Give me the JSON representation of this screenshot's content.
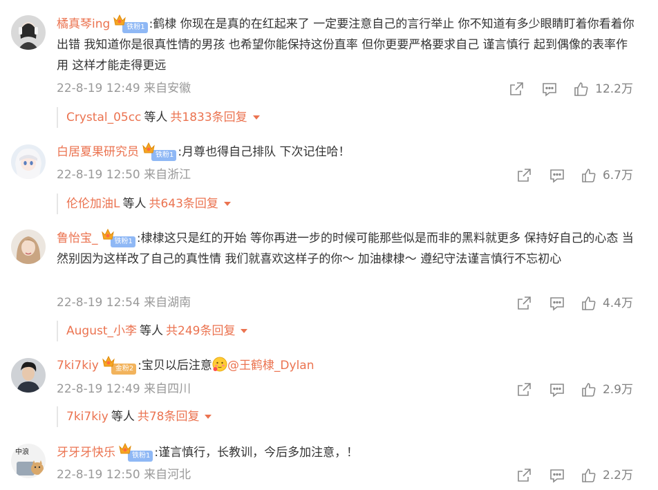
{
  "colors": {
    "username": "#eb7350",
    "meta": "#999999",
    "text": "#333333",
    "badge_blue": "#8fb8f5",
    "badge_gold": "#f2b35c"
  },
  "comments": [
    {
      "username": "橘真琴ing",
      "badge_label": "铁粉1",
      "badge_type": "blue",
      "text": ":鹤棣 你现在是真的在红起来了 一定要注意自己的言行举止 你不知道有多少眼睛盯着你看着你出错 我知道你是很真性情的男孩 也希望你能保持这份直率 但你更要严格要求自己 谨言慎行 起到偶像的表率作用 这样才能走得更远",
      "time": "22-8-19 12:49",
      "location": "来自安徽",
      "likes": "12.2万",
      "reply_user": "Crystal_05cc",
      "reply_mid": "等人",
      "reply_total": "共1833条回复",
      "icons": [
        "share-icon",
        "comment-icon",
        "like-icon",
        "chevron-down-icon"
      ]
    },
    {
      "username": "白居夏果研究员",
      "badge_label": "铁粉1",
      "badge_type": "blue",
      "text": ":月尊也得自己排队 下次记住哈！",
      "time": "22-8-19 12:50",
      "location": "来自浙江",
      "likes": "6.7万",
      "reply_user": "伦伦加油L",
      "reply_mid": "等人",
      "reply_total": "共643条回复"
    },
    {
      "username": "鲁怡宝_",
      "badge_label": "铁粉1",
      "badge_type": "blue",
      "text": ":棣棣这只是红的开始 等你再进一步的时候可能那些似是而非的黑料就更多 保持好自己的心态 当然别因为这样改了自己的真性情 我们就喜欢这样子的你～ 加油棣棣～  遵纪守法谨言慎行不忘初心",
      "time": "22-8-19 12:54",
      "location": "来自湖南",
      "likes": "4.4万",
      "reply_user": "August_小李",
      "reply_mid": "等人",
      "reply_total": "共249条回复"
    },
    {
      "username": "7ki7kiy",
      "badge_label": "金粉2",
      "badge_type": "gold",
      "text_before": ":宝贝以后注意",
      "mention": "@王鹤棣_Dylan",
      "time": "22-8-19 12:49",
      "location": "来自四川",
      "likes": "2.9万",
      "reply_user": "7ki7kiy",
      "reply_mid": "等人",
      "reply_total": "共78条回复"
    },
    {
      "username": "牙牙牙快乐",
      "badge_label": "铁粉1",
      "badge_type": "blue",
      "text": ":谨言慎行，长教训，今后多加注意，！",
      "time": "22-8-19 12:50",
      "location": "来自河北",
      "likes": "2.2万"
    }
  ]
}
